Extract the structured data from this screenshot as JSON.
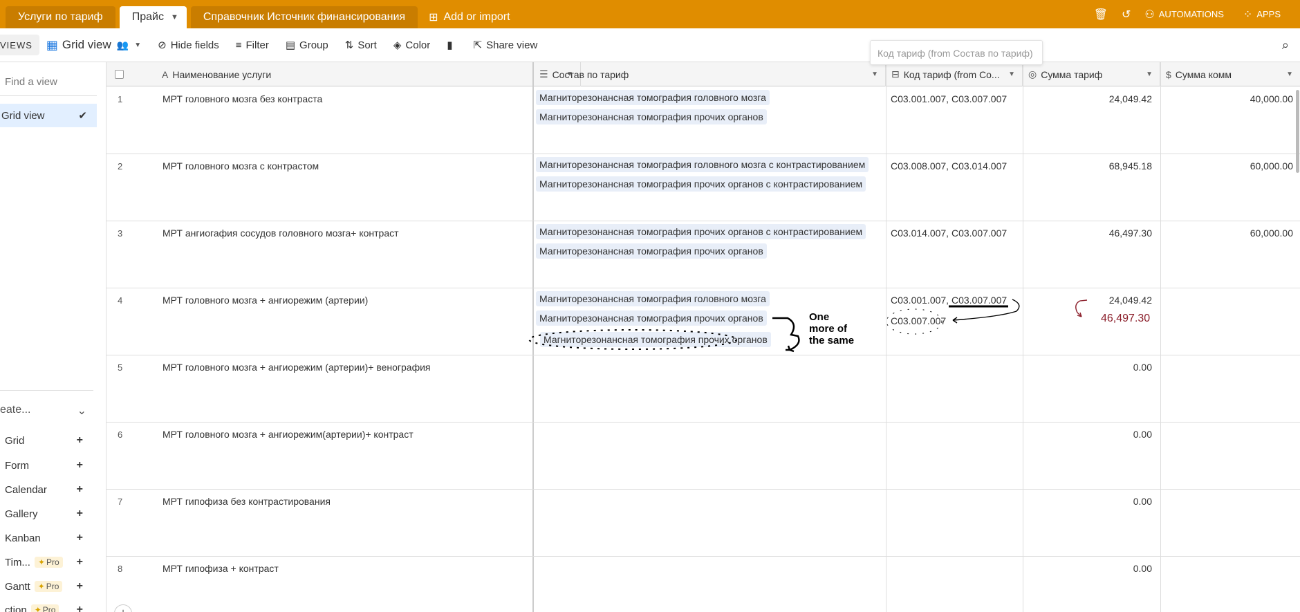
{
  "tabs": [
    {
      "label": "Услуги по тариф"
    },
    {
      "label": "Прайс"
    },
    {
      "label": "Справочник Источник финансирования"
    }
  ],
  "add_import": "Add or import",
  "top_right": {
    "automations": "AUTOMATIONS",
    "apps": "APPS"
  },
  "toolbar": {
    "views": "VIEWS",
    "grid_view": "Grid view",
    "hide_fields": "Hide fields",
    "filter": "Filter",
    "group": "Group",
    "sort": "Sort",
    "color": "Color",
    "share_view": "Share view"
  },
  "tooltip": "Код тариф (from Состав по тариф)",
  "sidebar": {
    "find_view": "Find a view",
    "current_view": "Grid view",
    "create": "eate...",
    "items": [
      {
        "label": "Grid"
      },
      {
        "label": "Form"
      },
      {
        "label": "Calendar"
      },
      {
        "label": "Gallery"
      },
      {
        "label": "Kanban"
      },
      {
        "label": "Tim...",
        "badge": "Pro"
      },
      {
        "label": "Gantt",
        "badge": "Pro"
      },
      {
        "label": "ction",
        "badge": "Pro"
      }
    ]
  },
  "columns": {
    "name": "Наименование услуги",
    "composition": "Состав по тариф",
    "code": "Код тариф (from Co...",
    "sum_tariff": "Сумма тариф",
    "sum_comm": "Сумма комм"
  },
  "rows": [
    {
      "num": "1",
      "name": "МРТ головного мозга без контраста",
      "chips": [
        "Магниторезонансная томография головного мозга",
        "Магниторезонансная томография прочих органов"
      ],
      "code": "C03.001.007, C03.007.007",
      "sum": "24,049.42",
      "comm": "40,000.00"
    },
    {
      "num": "2",
      "name": "МРТ головного мозга с контрастом",
      "chips": [
        "Магниторезонансная томография головного мозга с контрастированием",
        "Магниторезонансная томография прочих органов с контрастированием"
      ],
      "code": "C03.008.007, C03.014.007",
      "sum": "68,945.18",
      "comm": "60,000.00"
    },
    {
      "num": "3",
      "name": "МРТ ангиогафия сосудов головного мозга+ контраст",
      "chips": [
        "Магниторезонансная томография прочих органов с контрастированием",
        "Магниторезонансная томография прочих органов"
      ],
      "code": "C03.014.007, C03.007.007",
      "sum": "46,497.30",
      "comm": "60,000.00"
    },
    {
      "num": "4",
      "name": "МРТ головного мозга + ангиорежим (артерии)",
      "chips": [
        "Магниторезонансная томография головного мозга",
        "Магниторезонансная томография прочих органов",
        "Магниторезонансная томография прочих органов"
      ],
      "code": "C03.001.007, C03.007.007",
      "code_extra": "C03.007.007",
      "sum": "24,049.42",
      "sum_extra": "46,497.30",
      "comm": ""
    },
    {
      "num": "5",
      "name": "МРТ головного мозга + ангиорежим (артерии)+ венография",
      "chips": [],
      "code": "",
      "sum": "0.00",
      "comm": ""
    },
    {
      "num": "6",
      "name": "МРТ головного мозга  + ангиорежим(артерии)+ контраст",
      "chips": [],
      "code": "",
      "sum": "0.00",
      "comm": ""
    },
    {
      "num": "7",
      "name": "МРТ гипофиза без контрастирования",
      "chips": [],
      "code": "",
      "sum": "0.00",
      "comm": ""
    },
    {
      "num": "8",
      "name": "МРТ гипофиза + контраст",
      "chips": [],
      "code": "",
      "sum": "0.00",
      "comm": ""
    }
  ],
  "annotation": "One more of the same"
}
